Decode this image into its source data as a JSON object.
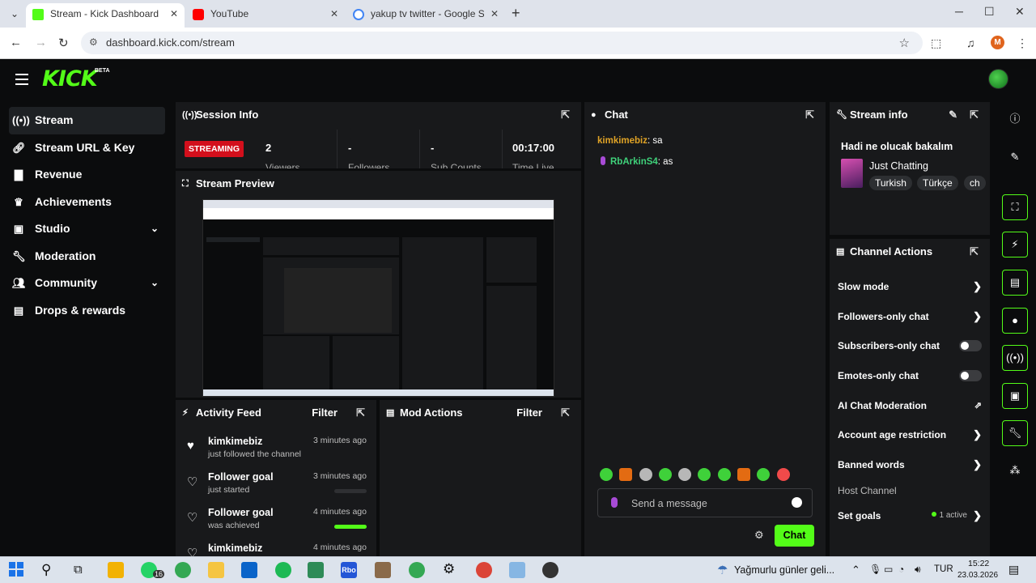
{
  "browser": {
    "tabs": [
      {
        "title": "Stream - Kick Dashboard",
        "favicon_color": "#53fc18",
        "active": true
      },
      {
        "title": "YouTube",
        "favicon_color": "#ff0000",
        "active": false
      },
      {
        "title": "yakup tv twitter - Google Search",
        "favicon_color": "#4285f4",
        "active": false
      }
    ],
    "url": "dashboard.kick.com/stream",
    "profile_initial": "M"
  },
  "app": {
    "logo": "KICK",
    "beta": "BETA"
  },
  "sidebar": {
    "items": [
      {
        "label": "Stream",
        "icon": "broadcast-icon",
        "active": true,
        "expandable": false
      },
      {
        "label": "Stream URL & Key",
        "icon": "link-icon",
        "active": false,
        "expandable": false
      },
      {
        "label": "Revenue",
        "icon": "chart-icon",
        "active": false,
        "expandable": false
      },
      {
        "label": "Achievements",
        "icon": "trophy-icon",
        "active": false,
        "expandable": false
      },
      {
        "label": "Studio",
        "icon": "studio-icon",
        "active": false,
        "expandable": true
      },
      {
        "label": "Moderation",
        "icon": "wrench-icon",
        "active": false,
        "expandable": false
      },
      {
        "label": "Community",
        "icon": "people-icon",
        "active": false,
        "expandable": true
      },
      {
        "label": "Drops & rewards",
        "icon": "gift-icon",
        "active": false,
        "expandable": false
      }
    ]
  },
  "session": {
    "title": "Session Info",
    "status": "STREAMING",
    "stats": [
      {
        "value": "2",
        "label": "Viewers"
      },
      {
        "value": "-",
        "label": "Followers"
      },
      {
        "value": "-",
        "label": "Sub Counts"
      },
      {
        "value": "00:17:00",
        "label": "Time Live"
      }
    ]
  },
  "preview": {
    "title": "Stream Preview"
  },
  "activity": {
    "title": "Activity Feed",
    "filter": "Filter",
    "items": [
      {
        "name": "kimkimebiz",
        "sub": "just followed the channel",
        "time": "3 minutes ago",
        "icon": "heart-filled-icon",
        "progress": null
      },
      {
        "name": "Follower goal",
        "sub": "just started",
        "time": "3 minutes ago",
        "icon": "heart-outline-icon",
        "progress": 0.0
      },
      {
        "name": "Follower goal",
        "sub": "was achieved",
        "time": "4 minutes ago",
        "icon": "heart-outline-icon",
        "progress": 1.0
      },
      {
        "name": "kimkimebiz",
        "sub": "",
        "time": "4 minutes ago",
        "icon": "heart-outline-icon",
        "progress": null
      }
    ]
  },
  "mod_actions": {
    "title": "Mod Actions",
    "filter": "Filter"
  },
  "chat": {
    "title": "Chat",
    "messages": [
      {
        "user": "kimkimebiz",
        "text": ": sa",
        "color": "#e0a326",
        "badge": false
      },
      {
        "user": "RbArkinS4",
        "text": ": as",
        "color": "#3fd17a",
        "badge": true
      }
    ],
    "input_placeholder": "Send a message",
    "send_label": "Chat"
  },
  "stream_info": {
    "title": "Stream info",
    "stream_title": "Hadi ne olucak bakalım",
    "category": "Just Chatting",
    "tags": [
      "Turkish",
      "Türkçe",
      "ch"
    ]
  },
  "channel_actions": {
    "title": "Channel Actions",
    "items": [
      {
        "label": "Slow mode",
        "control": "chevron"
      },
      {
        "label": "Followers-only chat",
        "control": "chevron"
      },
      {
        "label": "Subscribers-only chat",
        "control": "toggle",
        "on": false
      },
      {
        "label": "Emotes-only chat",
        "control": "toggle",
        "on": false
      },
      {
        "label": "AI Chat Moderation",
        "control": "external"
      },
      {
        "label": "Account age restriction",
        "control": "chevron"
      },
      {
        "label": "Banned words",
        "control": "chevron"
      },
      {
        "label": "Host Channel",
        "control": "none",
        "dim": true
      },
      {
        "label": "Set goals",
        "control": "chevron",
        "badge": "1 active"
      }
    ]
  },
  "rail": [
    "info-icon",
    "edit-icon",
    "scan-icon",
    "bolt-icon",
    "doc-icon",
    "chat-bubble-icon",
    "broadcast-icon",
    "panel-icon",
    "wrench-icon",
    "share-icon"
  ],
  "taskbar": {
    "weather": "Yağmurlu günler geli...",
    "lang": "TUR",
    "time": "15:22",
    "date": "23.03.2026",
    "whatsapp_badge": "16",
    "roblox_label": "Rbo"
  }
}
